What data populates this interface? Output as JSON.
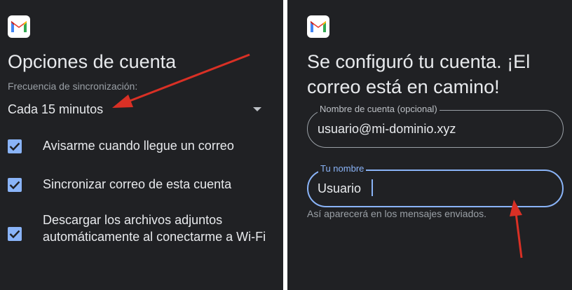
{
  "left": {
    "title": "Opciones de cuenta",
    "sync_frequency": {
      "label": "Frecuencia de sincronización:",
      "value": "Cada 15 minutos"
    },
    "options": [
      {
        "label": "Avisarme cuando llegue un correo",
        "checked": true
      },
      {
        "label": "Sincronizar correo de esta cuenta",
        "checked": true
      },
      {
        "label": "Descargar los archivos adjuntos automáticamente al conectarme a Wi-Fi",
        "checked": true
      }
    ]
  },
  "right": {
    "title": "Se configuró tu cuenta. ¡El correo está en camino!",
    "account_name": {
      "label": "Nombre de cuenta (opcional)",
      "value": "usuario@mi-dominio.xyz"
    },
    "your_name": {
      "label": "Tu nombre",
      "value": "Usuario",
      "helper": "Así aparecerá en los mensajes enviados."
    }
  },
  "colors": {
    "background": "#202124",
    "text": "#e8eaed",
    "muted_text": "#9aa0a6",
    "accent_blue": "#8ab4f8",
    "annotation_red": "#d93025"
  },
  "icons": [
    "gmail-logo",
    "dropdown-arrow-icon",
    "checkbox-checked-icon",
    "annotation-arrow"
  ]
}
